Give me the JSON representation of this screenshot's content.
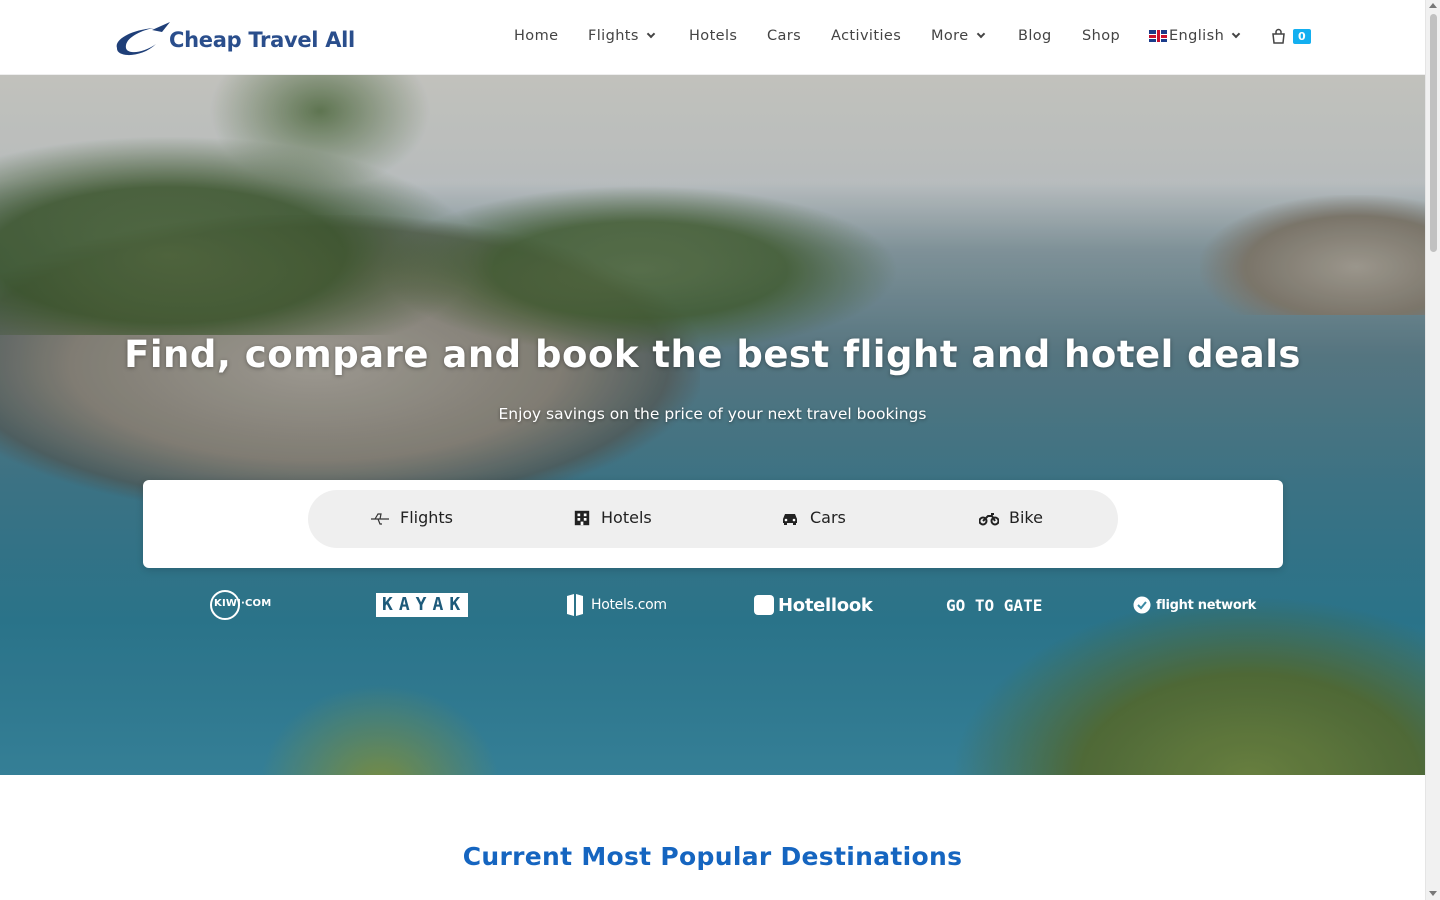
{
  "brand": {
    "name": "Cheap Travel All",
    "color": "#2a4e8c",
    "accent": "#13aff0"
  },
  "nav": {
    "items": [
      {
        "label": "Home",
        "dropdown": false
      },
      {
        "label": "Flights",
        "dropdown": true
      },
      {
        "label": "Hotels",
        "dropdown": false
      },
      {
        "label": "Cars",
        "dropdown": false
      },
      {
        "label": "Activities",
        "dropdown": false
      },
      {
        "label": "More",
        "dropdown": true
      },
      {
        "label": "Blog",
        "dropdown": false
      },
      {
        "label": "Shop",
        "dropdown": false
      }
    ],
    "language": {
      "label": "English",
      "icon": "uk-flag-icon"
    },
    "cart": {
      "icon": "shopping-bag-icon",
      "count": "0"
    }
  },
  "hero": {
    "title": "Find, compare and book the best flight and hotel deals",
    "subtitle": "Enjoy savings on the price of your next travel bookings"
  },
  "search_tabs": [
    {
      "label": "Flights",
      "icon": "plane-icon"
    },
    {
      "label": "Hotels",
      "icon": "building-icon"
    },
    {
      "label": "Cars",
      "icon": "car-icon"
    },
    {
      "label": "Bike",
      "icon": "motorcycle-icon"
    }
  ],
  "partners": [
    {
      "name": "KIWI·COM"
    },
    {
      "name": "KAYAK"
    },
    {
      "name": "Hotels.com"
    },
    {
      "name": "Hotellook"
    },
    {
      "name": "GO TO GATE"
    },
    {
      "name": "flight network"
    }
  ],
  "section": {
    "title": "Current Most Popular Destinations",
    "color": "#1565c0"
  }
}
